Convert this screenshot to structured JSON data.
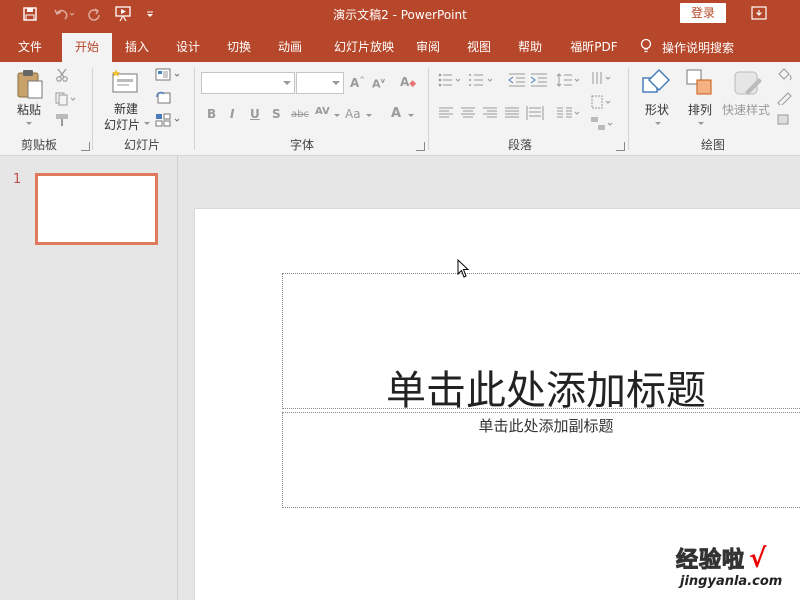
{
  "titlebar": {
    "title": "演示文稿2  -  PowerPoint",
    "login_label": "登录"
  },
  "tabs": [
    {
      "label": "文件"
    },
    {
      "label": "开始"
    },
    {
      "label": "插入"
    },
    {
      "label": "设计"
    },
    {
      "label": "切换"
    },
    {
      "label": "动画"
    },
    {
      "label": "幻灯片放映"
    },
    {
      "label": "审阅"
    },
    {
      "label": "视图"
    },
    {
      "label": "帮助"
    },
    {
      "label": "福昕PDF"
    }
  ],
  "tellme": {
    "label": "操作说明搜索"
  },
  "ribbon": {
    "clipboard": {
      "paste_label": "粘贴",
      "group_label": "剪贴板"
    },
    "slides": {
      "new_slide_label_1": "新建",
      "new_slide_label_2": "幻灯片",
      "group_label": "幻灯片"
    },
    "font": {
      "group_label": "字体",
      "font_name": "",
      "font_size": ""
    },
    "paragraph": {
      "group_label": "段落"
    },
    "drawing": {
      "shape_label": "形状",
      "arrange_label": "排列",
      "quick_style_label": "快速样式",
      "group_label": "绘图"
    }
  },
  "slide_panel": {
    "slide_number": "1"
  },
  "slide": {
    "title_placeholder": "单击此处添加标题",
    "subtitle_placeholder": "单击此处添加副标题"
  },
  "watermark": {
    "brand": "经验啦",
    "url": "jingyanla.com",
    "check": "√"
  },
  "colors": {
    "accent": "#b7472a",
    "thumb_border": "#e07a5f"
  }
}
